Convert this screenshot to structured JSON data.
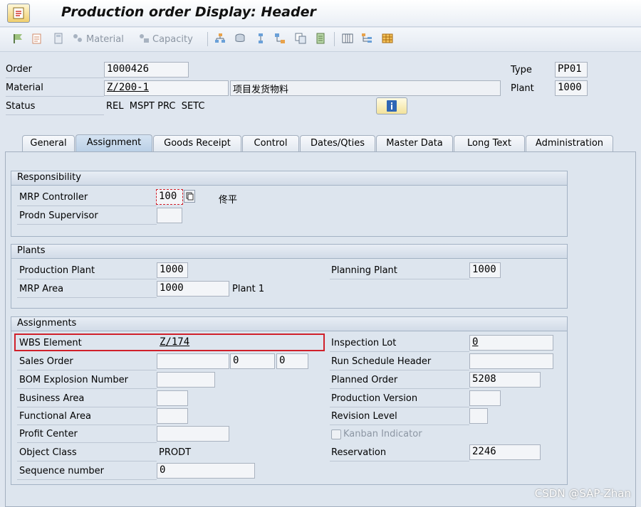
{
  "window": {
    "title": "Production order Display: Header"
  },
  "toolbar": {
    "material_label": "Material",
    "capacity_label": "Capacity"
  },
  "header": {
    "order_label": "Order",
    "order_value": "1000426",
    "material_label": "Material",
    "material_value": "Z/200-1",
    "material_desc": "项目发货物料",
    "status_label": "Status",
    "status_value": "REL  MSPT PRC  SETC",
    "type_label": "Type",
    "type_value": "PP01",
    "plant_label": "Plant",
    "plant_value": "1000"
  },
  "tabs": [
    {
      "label": "General"
    },
    {
      "label": "Assignment"
    },
    {
      "label": "Goods Receipt"
    },
    {
      "label": "Control"
    },
    {
      "label": "Dates/Qties"
    },
    {
      "label": "Master Data"
    },
    {
      "label": "Long Text"
    },
    {
      "label": "Administration"
    }
  ],
  "responsibility": {
    "title": "Responsibility",
    "mrp_controller_label": "MRP Controller",
    "mrp_controller_value": "100",
    "mrp_controller_name": "佟平",
    "prodn_supervisor_label": "Prodn Supervisor",
    "prodn_supervisor_value": ""
  },
  "plants": {
    "title": "Plants",
    "production_plant_label": "Production Plant",
    "production_plant_value": "1000",
    "planning_plant_label": "Planning Plant",
    "planning_plant_value": "1000",
    "mrp_area_label": "MRP Area",
    "mrp_area_value": "1000",
    "mrp_area_desc": "Plant 1"
  },
  "assignments": {
    "title": "Assignments",
    "wbs_label": "WBS Element",
    "wbs_value": "Z/174",
    "sales_order_label": "Sales Order",
    "sales_order_value": "",
    "sales_item_value": "0",
    "sales_schedule_value": "0",
    "bom_label": "BOM Explosion Number",
    "bom_value": "",
    "business_area_label": "Business Area",
    "business_area_value": "",
    "functional_area_label": "Functional Area",
    "functional_area_value": "",
    "profit_center_label": "Profit Center",
    "profit_center_value": "",
    "object_class_label": "Object Class",
    "object_class_value": "PRODT",
    "sequence_label": "Sequence number",
    "sequence_value": "0",
    "inspection_lot_label": "Inspection Lot",
    "inspection_lot_value": "0",
    "run_schedule_label": "Run Schedule Header",
    "run_schedule_value": "",
    "planned_order_label": "Planned Order",
    "planned_order_value": "5208",
    "production_version_label": "Production Version",
    "production_version_value": "",
    "revision_level_label": "Revision Level",
    "revision_level_value": "",
    "kanban_label": "Kanban Indicator",
    "reservation_label": "Reservation",
    "reservation_value": "2246"
  },
  "watermark": "CSDN @SAP-Zhan",
  "colors": {
    "highlight_box": "#d0202a",
    "panel_bg": "#dde5ee"
  }
}
